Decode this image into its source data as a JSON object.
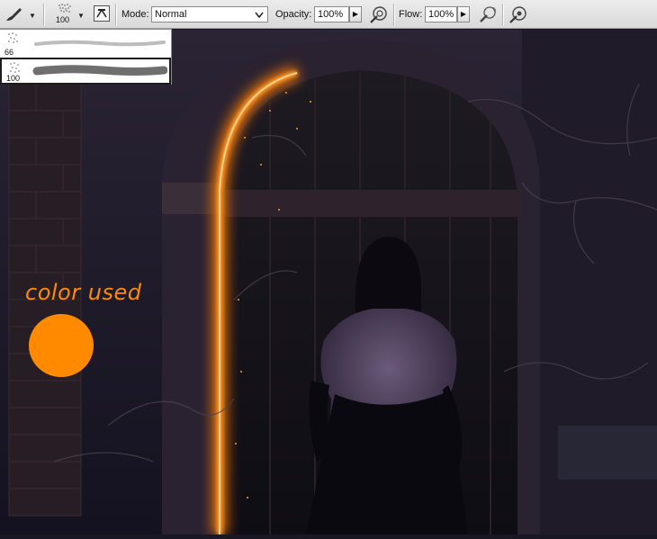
{
  "toolbar": {
    "brush_tool_icon": "brush-icon",
    "brush_size": "100",
    "mode_label": "Mode:",
    "mode_value": "Normal",
    "opacity_label": "Opacity:",
    "opacity_value": "100%",
    "flow_label": "Flow:",
    "flow_value": "100%",
    "icons": [
      "brush-icon",
      "brush-preset-thumb-icon",
      "toggle-brush-panel-icon",
      "pressure-opacity-icon",
      "airbrush-icon",
      "pressure-size-icon"
    ]
  },
  "brush_presets": [
    {
      "size": "66"
    },
    {
      "size": "100"
    }
  ],
  "annotation": {
    "text": "color used",
    "color": "#ff8c00",
    "swatch_color": "#ff8a00"
  },
  "colors": {
    "glow": "#ff8c1a",
    "background": "#1a1724"
  }
}
